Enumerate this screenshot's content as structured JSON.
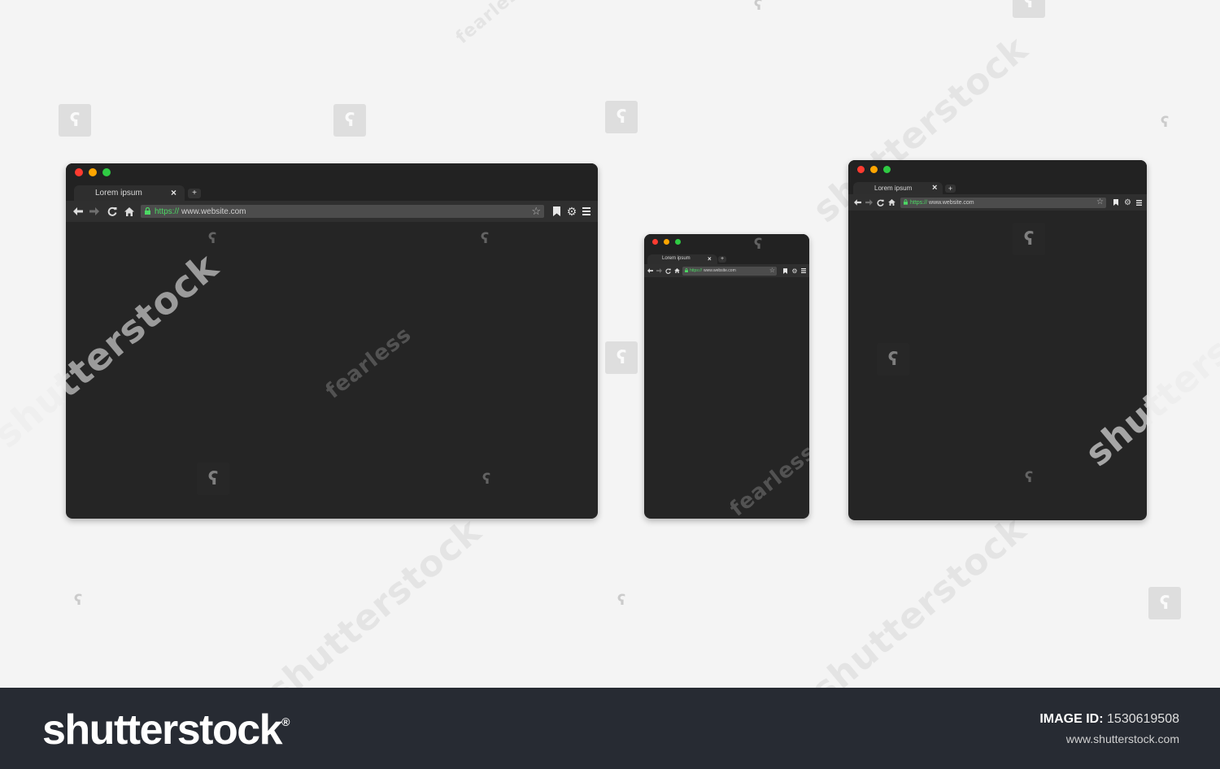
{
  "watermark": {
    "logo_glyph": "ʕ",
    "brand_text": "shutterstock",
    "fearless_text": "fearless"
  },
  "icons": [
    "back-arrow-icon",
    "forward-arrow-icon",
    "reload-icon",
    "home-icon",
    "lock-icon",
    "star-icon",
    "bookmark-icon",
    "gear-icon",
    "menu-icon",
    "close-icon",
    "plus-icon"
  ],
  "colors": {
    "background": "#f4f4f4",
    "window": "#252525",
    "toolbar": "#2f2f2f",
    "address_bar": "#4c4c4c",
    "dot_red": "#ff3b30",
    "dot_yellow": "#ffa500",
    "dot_green": "#2fcb43",
    "secure_green": "#4cd964",
    "footer": "#272b33"
  },
  "browsers": {
    "desktop": {
      "tab_title": "Lorem ipsum",
      "close_glyph": "×",
      "new_tab_glyph": "+",
      "url_scheme": "https://",
      "url_host": "www.website.com"
    },
    "phone": {
      "tab_title": "Lorem ipsum",
      "close_glyph": "×",
      "new_tab_glyph": "+",
      "url_scheme": "https://",
      "url_host": "www.website.com"
    },
    "tablet": {
      "tab_title": "Lorem ipsum",
      "close_glyph": "×",
      "new_tab_glyph": "+",
      "url_scheme": "https://",
      "url_host": "www.website.com"
    }
  },
  "footer": {
    "brand": "shutterstock",
    "registered_mark": "®",
    "image_id_label": "IMAGE ID:",
    "image_id_value": "1530619508",
    "site": "www.shutterstock.com"
  }
}
